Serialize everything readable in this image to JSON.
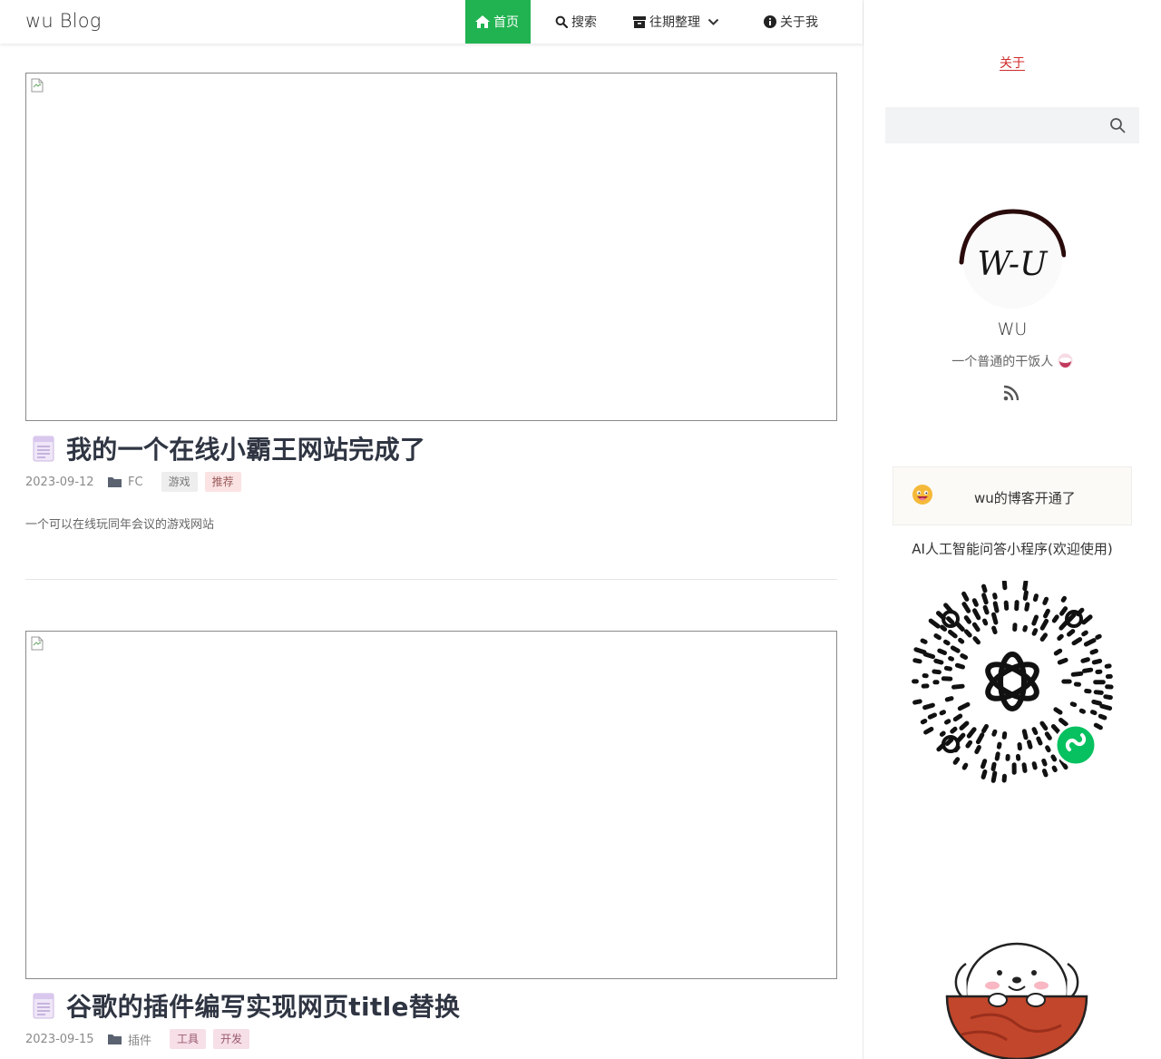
{
  "header": {
    "brand": "wu Blog",
    "nav": [
      {
        "label": "首页",
        "icon": "home-icon",
        "active": true
      },
      {
        "label": "搜索",
        "icon": "search-icon"
      },
      {
        "label": "往期整理",
        "icon": "archive-icon",
        "dropdown": true
      },
      {
        "label": "关于我",
        "icon": "info-icon"
      }
    ]
  },
  "posts": [
    {
      "title": "我的一个在线小霸王网站完成了",
      "date": "2023-09-12",
      "category": "FC",
      "tags": [
        {
          "label": "游戏",
          "bg": "#eeeeee",
          "color": "#777777"
        },
        {
          "label": "推荐",
          "bg": "#fbe3e3",
          "color": "#9a5a5a"
        }
      ],
      "excerpt": "一个可以在线玩同年会议的游戏网站"
    },
    {
      "title": "谷歌的插件编写实现网页title替换",
      "date": "2023-09-15",
      "category": "插件",
      "tags": [
        {
          "label": "工具",
          "bg": "#f7dfe8",
          "color": "#9a5a6e"
        },
        {
          "label": "开发",
          "bg": "#f7dfe8",
          "color": "#9a5a6e"
        }
      ],
      "excerpt": ""
    }
  ],
  "sidebar": {
    "about_link": "关于",
    "search_placeholder": "",
    "avatar_text": "W-U",
    "profile_name": "WU",
    "profile_bio": "一个普通的干饭人",
    "notice_text": "wu的博客开通了",
    "ai_label": "AI人工智能问答小程序(欢迎使用)"
  },
  "colors": {
    "accent": "#21b351",
    "about_link": "#d02b2b",
    "title": "#2f3542"
  }
}
